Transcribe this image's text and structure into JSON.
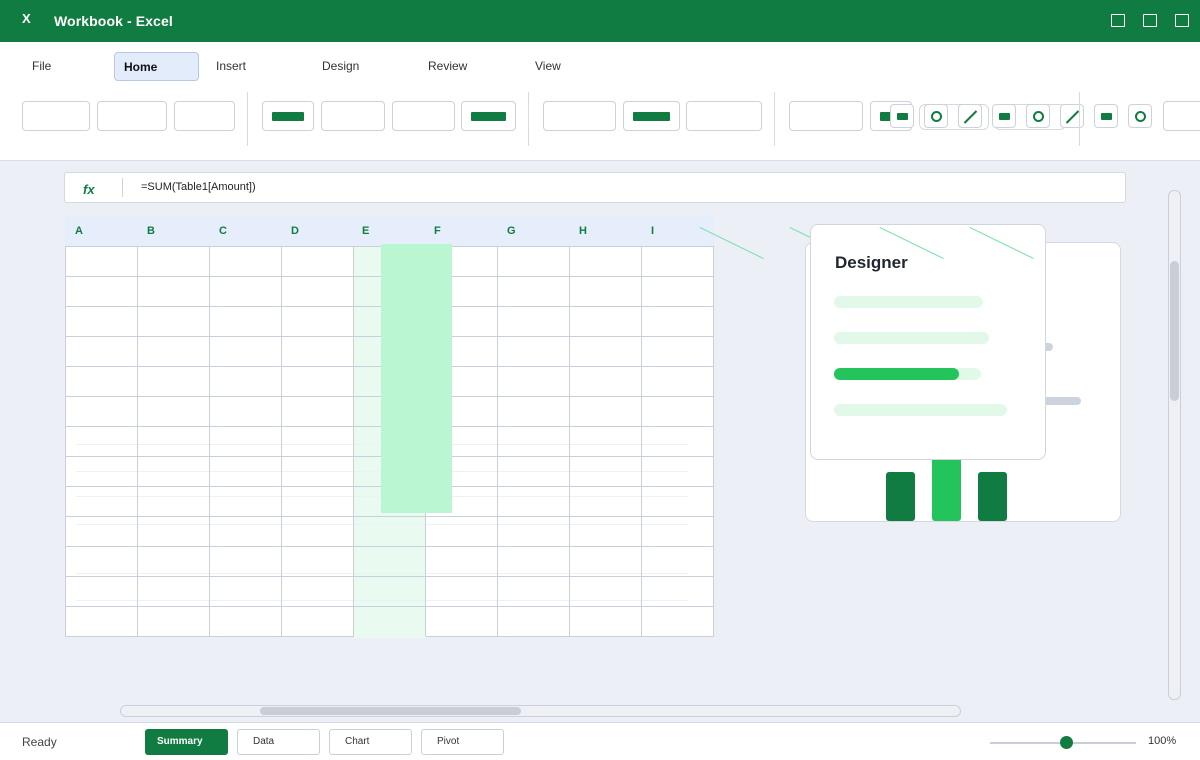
{
  "window": {
    "app_icon": "X",
    "title": "Workbook - Excel"
  },
  "ribbon": {
    "tabs": [
      {
        "label": "File",
        "active": false
      },
      {
        "label": "Home",
        "active": true
      },
      {
        "label": "Insert",
        "active": false
      },
      {
        "label": "Design",
        "active": false
      },
      {
        "label": "Review",
        "active": false
      },
      {
        "label": "View",
        "active": false
      }
    ]
  },
  "formula_bar": {
    "fx_label": "fx",
    "formula": "=SUM(Table1[Amount])"
  },
  "grid": {
    "columns": [
      "A",
      "B",
      "C",
      "D",
      "E",
      "F",
      "G",
      "H",
      "I"
    ],
    "visible_rows": 13,
    "selected_column": "F"
  },
  "designer": {
    "title": "Designer",
    "options": [
      {
        "progress": 0.0
      },
      {
        "progress": 0.0
      },
      {
        "progress": 0.85,
        "selected": true
      },
      {
        "progress": 0.0
      }
    ]
  },
  "status": {
    "text": "Ready",
    "sheets": [
      {
        "label": "Summary",
        "active": true
      },
      {
        "label": "Data",
        "active": false
      },
      {
        "label": "Chart",
        "active": false
      },
      {
        "label": "Pivot",
        "active": false
      }
    ],
    "zoom_label": "100%",
    "zoom_level": 0.48
  },
  "colors": {
    "brand": "#107c41",
    "accent": "#22c45b",
    "selection": "#bbf6d3",
    "header": "#e6eefb"
  }
}
